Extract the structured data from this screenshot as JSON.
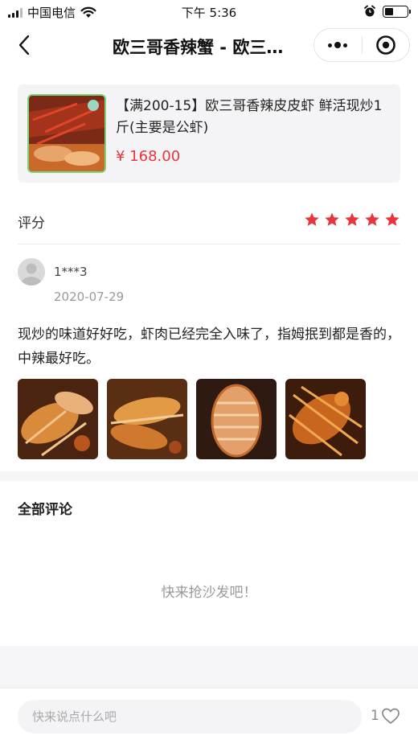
{
  "status_bar": {
    "carrier": "中国电信",
    "time": "下午 5:36"
  },
  "nav": {
    "title": "欧三哥香辣蟹 - 欧三…"
  },
  "product": {
    "title": "【满200-15】欧三哥香辣皮皮虾 鲜活现炒1斤(主要是公虾)",
    "price": "¥ 168.00",
    "thumb_icon": "product-photo-mantis-shrimp"
  },
  "rating": {
    "label": "评分",
    "stars": 5,
    "max_stars": 5,
    "star_color": "#e8363d"
  },
  "review": {
    "username": "1***3",
    "date": "2020-07-29",
    "text": "现炒的味道好好吃，虾肉已经完全入味了，指姆抿到都是香的，中辣最好吃。",
    "photo_count": 4
  },
  "all_comments": {
    "title": "全部评论",
    "empty": "快来抢沙发吧！"
  },
  "bottom": {
    "placeholder": "快来说点什么吧",
    "like_count": "1"
  },
  "colors": {
    "accent": "#e8363d",
    "muted": "#999999",
    "panel": "#f4f4f6"
  }
}
